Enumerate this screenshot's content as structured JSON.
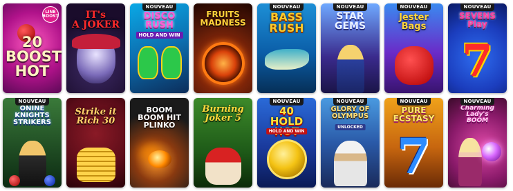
{
  "badge_label": "NOUVEAU",
  "games": [
    {
      "title": "20\nBOOST\nHOT",
      "sub": "",
      "corner": "LINE\nBOOST",
      "new": false
    },
    {
      "title": "IT's\nA JOKER",
      "sub": "",
      "corner": "",
      "new": false
    },
    {
      "title": "DISCO\nRUSH",
      "sub": "HOLD AND WIN",
      "corner": "",
      "new": true
    },
    {
      "title": "FRUITS\nMADNESS",
      "sub": "",
      "corner": "",
      "new": false
    },
    {
      "title": "BASS\nRUSH",
      "sub": "",
      "corner": "",
      "new": true
    },
    {
      "title": "STAR\nGEMS",
      "sub": "",
      "corner": "",
      "new": true
    },
    {
      "title": "Jester\nBags",
      "sub": "",
      "corner": "",
      "new": true
    },
    {
      "title": "SEVENS\nPlay",
      "sub": "",
      "corner": "",
      "new": true
    },
    {
      "title": "ONINE\nKNIGHTS\nSTRIKERS",
      "sub": "",
      "corner": "",
      "new": true
    },
    {
      "title": "Strike it\nRich 30",
      "sub": "",
      "corner": "",
      "new": false
    },
    {
      "title": "BOOM BOOM HIT\nPLINKO",
      "sub": "",
      "corner": "",
      "new": false
    },
    {
      "title": "Burning\nJoker 5",
      "sub": "",
      "corner": "",
      "new": false
    },
    {
      "title": "40\nHOLD HOT",
      "sub": "HOLD AND WIN",
      "corner": "",
      "new": true
    },
    {
      "title": "GLORY OF\nOLYMPUS",
      "sub": "UNLOCKED",
      "corner": "",
      "new": true
    },
    {
      "title": "PURE\nECSTASY",
      "sub": "",
      "corner": "",
      "new": true
    },
    {
      "title": "Charming Lady's\nBOOM",
      "sub": "",
      "corner": "",
      "new": true
    }
  ],
  "colors": {
    "boost_hot": "#b0128a",
    "joker": "#1a0c2b",
    "disco": "#0d8fd2",
    "fruits": "#5a1a08",
    "bass": "#0b5ea8",
    "stargems": "#3a2a8c",
    "jester": "#6a2bc8",
    "sevens": "#1b3dbd"
  }
}
